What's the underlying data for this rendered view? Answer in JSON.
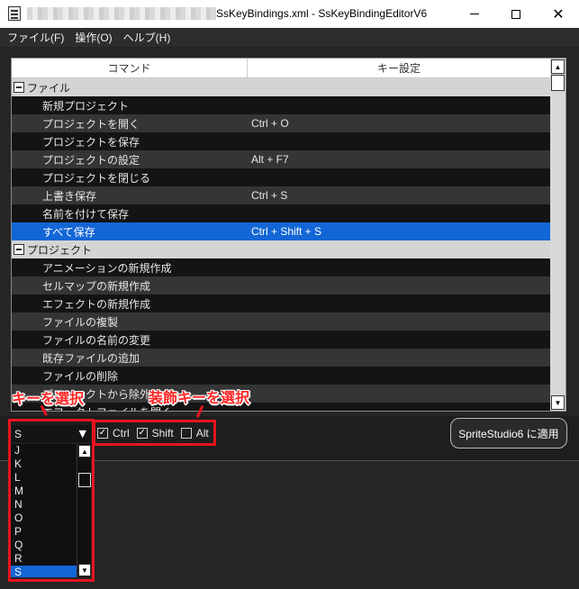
{
  "window": {
    "title": "SsKeyBindings.xml - SsKeyBindingEditorV6",
    "controls": {
      "minimize": "minimize-icon",
      "maximize": "maximize-icon",
      "close": "close-icon"
    }
  },
  "menubar": [
    "ファイル(F)",
    "操作(O)",
    "ヘルプ(H)"
  ],
  "table": {
    "headers": {
      "command": "コマンド",
      "key": "キー設定"
    },
    "rows": [
      {
        "type": "group",
        "label": "ファイル"
      },
      {
        "type": "item",
        "command": "新規プロジェクト",
        "key": ""
      },
      {
        "type": "item",
        "command": "プロジェクトを開く",
        "key": "Ctrl + O"
      },
      {
        "type": "item",
        "command": "プロジェクトを保存",
        "key": ""
      },
      {
        "type": "item",
        "command": "プロジェクトの設定",
        "key": "Alt + F7"
      },
      {
        "type": "item",
        "command": "プロジェクトを閉じる",
        "key": ""
      },
      {
        "type": "item",
        "command": "上書き保存",
        "key": "Ctrl + S"
      },
      {
        "type": "item",
        "command": "名前を付けて保存",
        "key": ""
      },
      {
        "type": "item",
        "command": "すべて保存",
        "key": "Ctrl + Shift + S",
        "selected": true
      },
      {
        "type": "group",
        "label": "プロジェクト"
      },
      {
        "type": "item",
        "command": "アニメーションの新規作成",
        "key": ""
      },
      {
        "type": "item",
        "command": "セルマップの新規作成",
        "key": ""
      },
      {
        "type": "item",
        "command": "エフェクトの新規作成",
        "key": ""
      },
      {
        "type": "item",
        "command": "ファイルの複製",
        "key": ""
      },
      {
        "type": "item",
        "command": "ファイルの名前の変更",
        "key": ""
      },
      {
        "type": "item",
        "command": "既存ファイルの追加",
        "key": ""
      },
      {
        "type": "item",
        "command": "ファイルの削除",
        "key": ""
      },
      {
        "type": "item",
        "command": "プロジェクトから除外",
        "key": ""
      },
      {
        "type": "item",
        "command": "エフェクトファイルを開く",
        "key": ""
      }
    ]
  },
  "key_selector": {
    "value": "S",
    "options": [
      "J",
      "K",
      "L",
      "M",
      "N",
      "O",
      "P",
      "Q",
      "R",
      "S"
    ],
    "selected": "S"
  },
  "modifiers": [
    {
      "label": "Ctrl",
      "checked": true
    },
    {
      "label": "Shift",
      "checked": true
    },
    {
      "label": "Alt",
      "checked": false
    }
  ],
  "apply_button": "SpriteStudio6 に適用",
  "annotations": {
    "key_select": "キーを選択",
    "modifier_select": "装飾キーを選択",
    "color": "#e8141e"
  }
}
